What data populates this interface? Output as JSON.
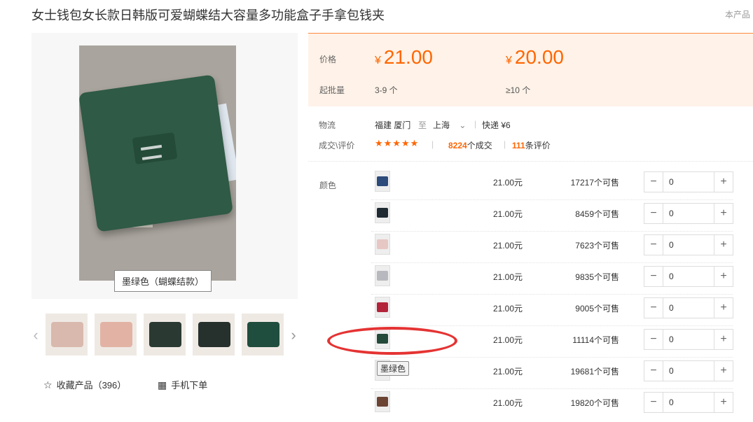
{
  "product": {
    "title": "女士钱包女长款日韩版可爱蝴蝶结大容量多功能盒子手拿包钱夹",
    "top_right": "本产品",
    "image_caption": "墨绿色（蝴蝶结款）"
  },
  "thumbnails": [
    {
      "color": "#d9b9ad"
    },
    {
      "color": "#e2b3a4"
    },
    {
      "color": "#2a3a33"
    },
    {
      "color": "#26302c"
    },
    {
      "color": "#1f4d3e"
    }
  ],
  "actions": {
    "favorite": "收藏产品（396）",
    "mobile": "手机下单"
  },
  "pricing": {
    "price_label": "价格",
    "currency": "¥",
    "price1": "21.00",
    "price2": "20.00",
    "moq_label": "起批量",
    "moq1": "3-9 个",
    "moq2": "≥10 个"
  },
  "logistics": {
    "label": "物流",
    "from": "福建 厦门",
    "to_word": "至",
    "to": "上海",
    "express": "快递 ¥6"
  },
  "reviews": {
    "label": "成交\\评价",
    "stars": "★★★★★",
    "deals_num": "8224",
    "deals_text": "个成交",
    "reviews_num": "111",
    "reviews_text": "条评价"
  },
  "sku": {
    "label": "颜色",
    "rows": [
      {
        "price": "21.00元",
        "stock": "17217个可售",
        "qty": "0",
        "swatch": "#2c4a7a"
      },
      {
        "price": "21.00元",
        "stock": "8459个可售",
        "qty": "0",
        "swatch": "#1f2a33"
      },
      {
        "price": "21.00元",
        "stock": "7623个可售",
        "qty": "0",
        "swatch": "#e7c7c4"
      },
      {
        "price": "21.00元",
        "stock": "9835个可售",
        "qty": "0",
        "swatch": "#b7b9bf"
      },
      {
        "price": "21.00元",
        "stock": "9005个可售",
        "qty": "0",
        "swatch": "#b3243a"
      },
      {
        "price": "21.00元",
        "stock": "11114个可售",
        "qty": "0",
        "swatch": "#244a3a"
      },
      {
        "price": "21.00元",
        "stock": "19681个可售",
        "qty": "0",
        "swatch": "#e07f9b"
      },
      {
        "price": "21.00元",
        "stock": "19820个可售",
        "qty": "0",
        "swatch": "#6b4434"
      }
    ],
    "tooltip": "墨绿色"
  },
  "colors": {
    "accent": "#ff6600",
    "price_bg": "#fff2e8",
    "annotation": "#e53333"
  }
}
